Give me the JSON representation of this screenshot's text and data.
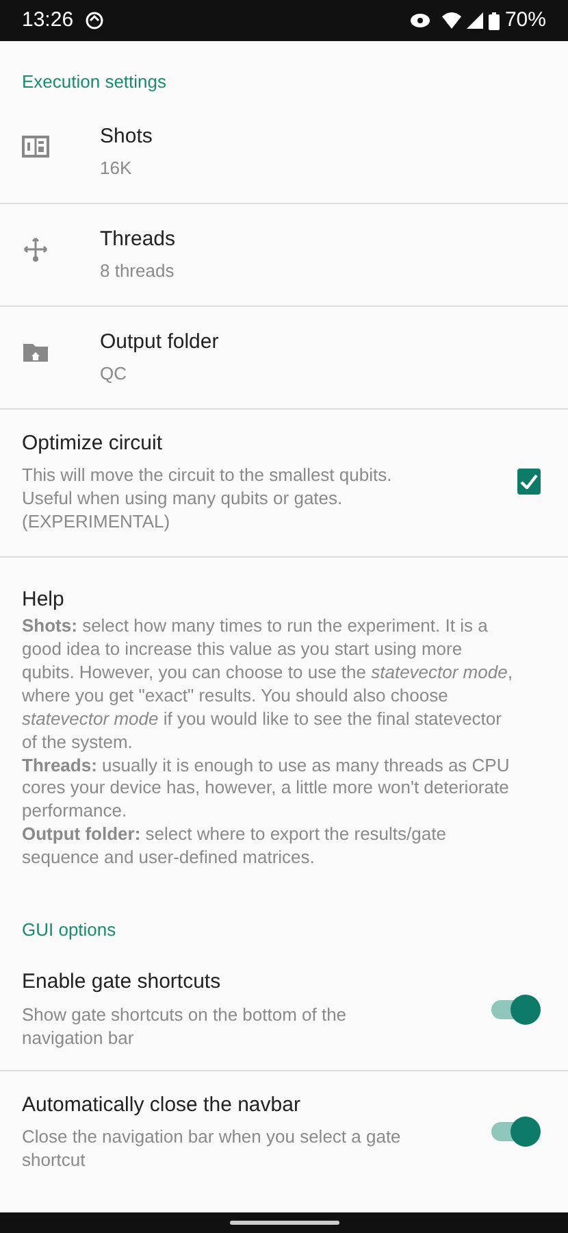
{
  "status_bar": {
    "time": "13:26",
    "battery": "70%"
  },
  "sections": [
    {
      "header": "Execution settings",
      "items": [
        {
          "kind": "icon",
          "title": "Shots",
          "summary": "16K"
        },
        {
          "kind": "icon",
          "title": "Threads",
          "summary": "8 threads"
        },
        {
          "kind": "icon",
          "title": "Output folder",
          "summary": "QC"
        },
        {
          "kind": "checkbox",
          "title": "Optimize circuit",
          "summary": "This will move the circuit to the smallest qubits. Useful when using many qubits or gates. (EXPERIMENTAL)",
          "checked": true
        },
        {
          "kind": "text",
          "title": "Help",
          "paragraphs": [
            "**Shots:** select how many times to run the experiment. It is a good idea to increase this value as you start using more qubits. However, you can choose to use the *statevector mode*, where you get \"exact\" results. You should also choose *statevector mode* if you would like to see the final statevector of the system.",
            "**Threads:** usually it is enough to use as many threads as CPU cores your device has, however, a little more won't deteriorate performance.",
            "**Output folder:** select where to export the results/gate sequence and user-defined matrices."
          ]
        }
      ]
    },
    {
      "header": "GUI options",
      "items": [
        {
          "kind": "switch",
          "title": "Enable gate shortcuts",
          "summary": "Show gate shortcuts on the bottom of the navigation bar",
          "on": true
        },
        {
          "kind": "switch",
          "title": "Automatically close the navbar",
          "summary": "Close the navigation bar when you select a gate shortcut",
          "on": true
        }
      ]
    }
  ]
}
